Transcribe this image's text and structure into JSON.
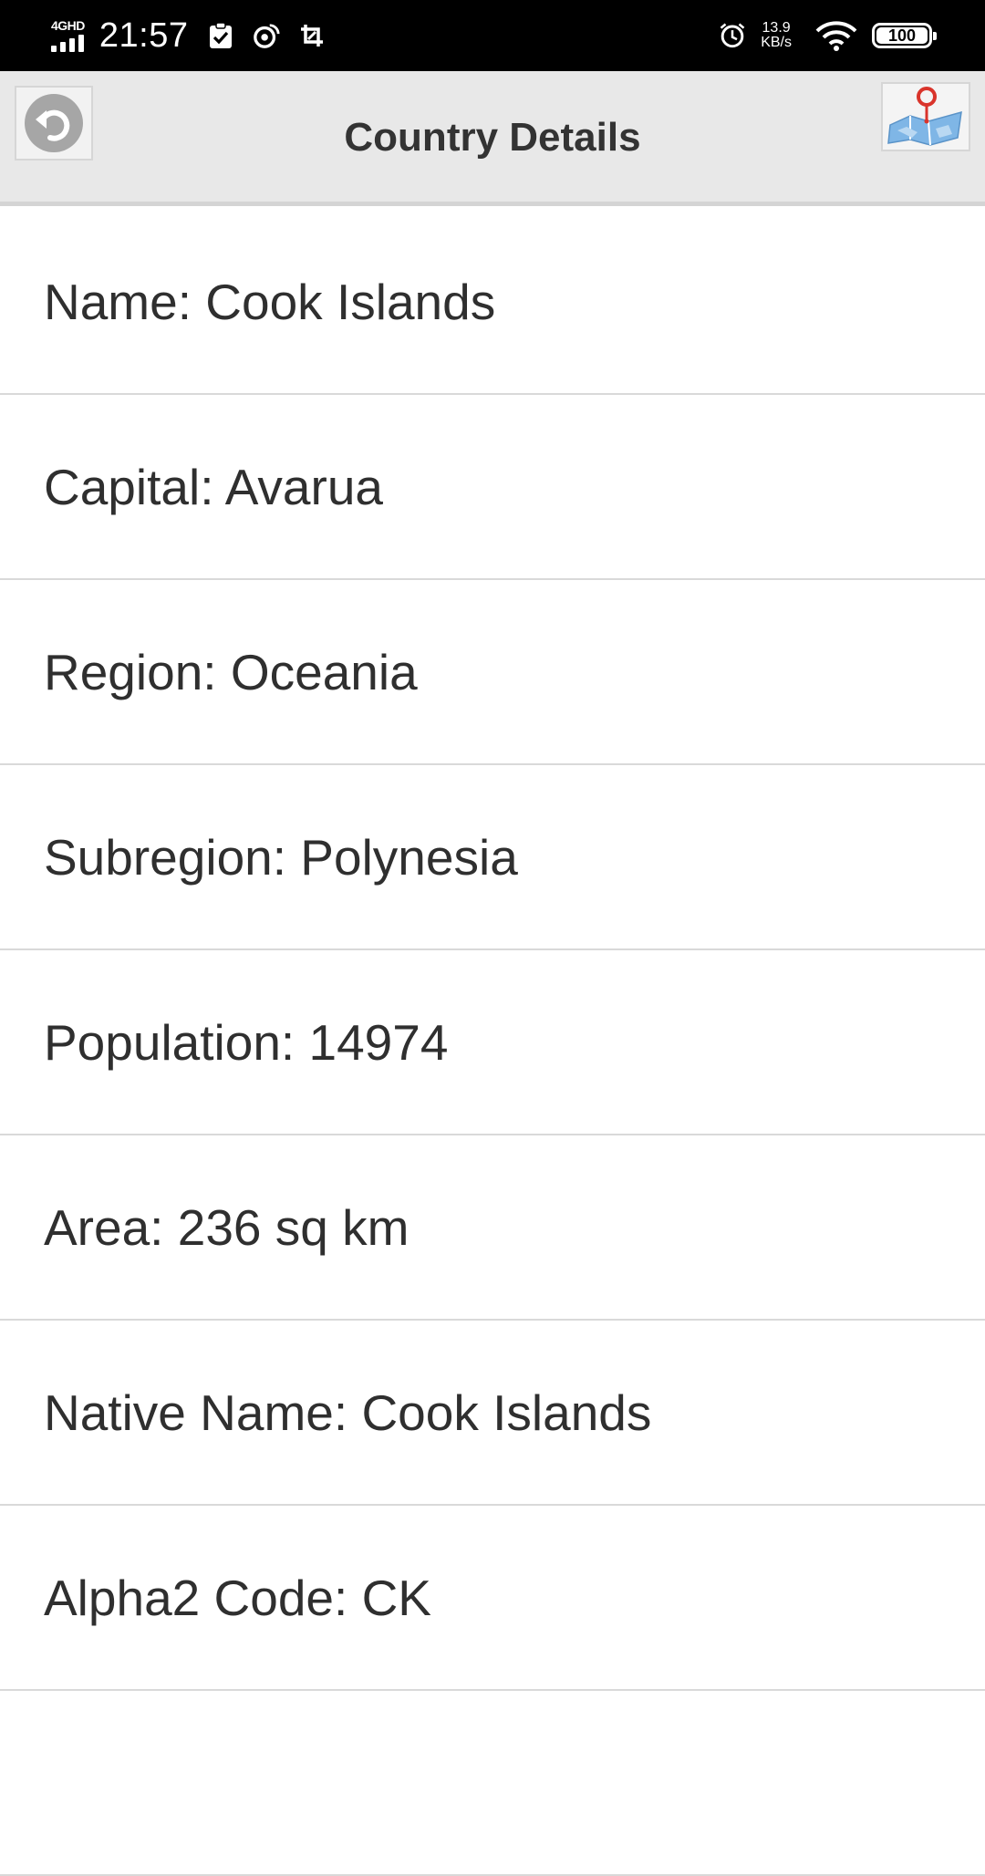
{
  "status_bar": {
    "network": "4GHD",
    "time": "21:57",
    "speed_value": "13.9",
    "speed_unit": "KB/s",
    "battery": "100",
    "battery_level": 1.0,
    "icons": [
      "signal-icon",
      "task-check-icon",
      "weibo-icon",
      "screenshot-icon",
      "alarm-icon",
      "wifi-icon",
      "battery-icon"
    ]
  },
  "header": {
    "title": "Country Details",
    "back_icon": "back-arrow-icon",
    "map_icon": "map-pin-icon"
  },
  "details": [
    {
      "text": "Name: Cook Islands"
    },
    {
      "text": "Capital: Avarua"
    },
    {
      "text": "Region: Oceania"
    },
    {
      "text": "Subregion: Polynesia"
    },
    {
      "text": "Population: 14974"
    },
    {
      "text": "Area: 236 sq km"
    },
    {
      "text": "Native Name: Cook Islands"
    },
    {
      "text": "Alpha2 Code: CK"
    },
    {
      "text": ""
    }
  ],
  "colors": {
    "status_bar_bg": "#000000",
    "header_bg": "#e8e8e8",
    "text": "#2f2f2f",
    "divider": "#d9d9d9",
    "map_pin": "#d9342b",
    "map_water": "#7fb6e6"
  }
}
